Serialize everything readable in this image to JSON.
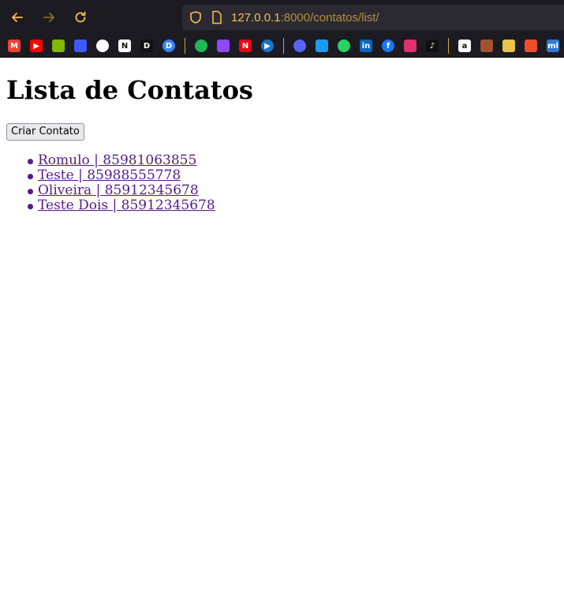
{
  "browser": {
    "url_host": "127.0.0.1",
    "url_rest": ":8000/contatos/list/",
    "bookmarks": [
      {
        "icon": "gmail-icon",
        "glyph": "M",
        "color": "#ea4335"
      },
      {
        "icon": "youtube-icon",
        "glyph": "▶",
        "color": "#ff0000"
      },
      {
        "icon": "microsoft-icon",
        "glyph": "",
        "color": "#7fba00"
      },
      {
        "icon": "discord-alt-icon",
        "glyph": "",
        "color": "#3d5afe"
      },
      {
        "icon": "github-icon",
        "glyph": "",
        "color": "#ffffff"
      },
      {
        "icon": "notion-icon",
        "glyph": "N",
        "color": "#ffffff"
      },
      {
        "icon": "dio-icon",
        "glyph": "D",
        "color": "#111111"
      },
      {
        "icon": "dio-blue-icon",
        "glyph": "D",
        "color": "#3b82f6"
      },
      {
        "icon": "spotify-icon",
        "glyph": "",
        "color": "#1db954"
      },
      {
        "icon": "twitch-icon",
        "glyph": "",
        "color": "#9146ff"
      },
      {
        "icon": "netflix-icon",
        "glyph": "N",
        "color": "#e50914"
      },
      {
        "icon": "play-icon",
        "glyph": "▶",
        "color": "#1a73c9"
      },
      {
        "icon": "discord-icon",
        "glyph": "",
        "color": "#5865f2"
      },
      {
        "icon": "twitter-icon",
        "glyph": "",
        "color": "#1d9bf0"
      },
      {
        "icon": "whatsapp-icon",
        "glyph": "",
        "color": "#25d366"
      },
      {
        "icon": "linkedin-icon",
        "glyph": "in",
        "color": "#0a66c2"
      },
      {
        "icon": "facebook-icon",
        "glyph": "f",
        "color": "#1877f2"
      },
      {
        "icon": "instagram-icon",
        "glyph": "",
        "color": "#e1306c"
      },
      {
        "icon": "tiktok-icon",
        "glyph": "♪",
        "color": "#111111"
      },
      {
        "icon": "amazon-icon",
        "glyph": "a",
        "color": "#ffffff"
      },
      {
        "icon": "monkey-icon",
        "glyph": "",
        "color": "#a0522d"
      },
      {
        "icon": "sandwich-icon",
        "glyph": "",
        "color": "#e6c34a"
      },
      {
        "icon": "shopee-icon",
        "glyph": "",
        "color": "#ee4d2d"
      },
      {
        "icon": "mercadolivre-icon",
        "glyph": "ml",
        "color": "#2d7bd6"
      },
      {
        "icon": "grid-icon",
        "glyph": "",
        "color": "#e8e8e8"
      }
    ]
  },
  "page": {
    "title": "Lista de Contatos",
    "create_button": "Criar Contato",
    "contacts": [
      "Romulo | 85981063855",
      "Teste | 85988555778",
      "Oliveira | 85912345678",
      "Teste Dois | 85912345678"
    ]
  }
}
